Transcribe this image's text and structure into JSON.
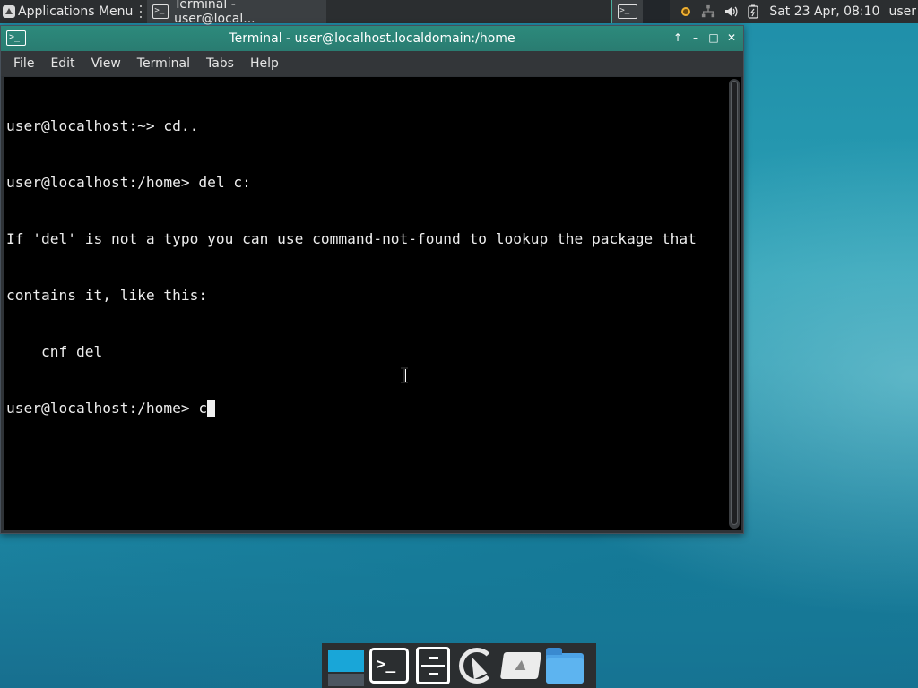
{
  "panel": {
    "apps_menu_label": "Applications Menu",
    "task_label": "Terminal - user@local...",
    "task_icon_glyph": ">_",
    "workspace_icon_glyph": ">_",
    "clock": "Sat 23 Apr, 08:10",
    "user": "user",
    "tray_icons": [
      "weather-icon",
      "network-icon",
      "volume-icon",
      "battery-icon"
    ]
  },
  "window": {
    "title": "Terminal - user@localhost.localdomain:/home",
    "icon_glyph": ">_",
    "controls": {
      "pin": "↑",
      "minimize": "–",
      "maximize": "□",
      "close": "✕"
    },
    "menu": [
      "File",
      "Edit",
      "View",
      "Terminal",
      "Tabs",
      "Help"
    ]
  },
  "terminal": {
    "lines": [
      "user@localhost:~> cd..",
      "user@localhost:/home> del c:",
      "If 'del' is not a typo you can use command-not-found to lookup the package that",
      "contains it, like this:",
      "    cnf del"
    ],
    "prompt": "user@localhost:/home> ",
    "current_input": "c"
  },
  "dock": {
    "terminal_glyph": ">_",
    "items": [
      "show-desktop",
      "terminal",
      "file-cabinet",
      "web-browser",
      "drive",
      "folder"
    ]
  },
  "colors": {
    "panel_bg": "#2b2e30",
    "titlebar_accent": "#2a7c71",
    "terminal_bg": "#000000",
    "terminal_fg": "#ededed",
    "desktop_accent": "#1f8ea8"
  }
}
